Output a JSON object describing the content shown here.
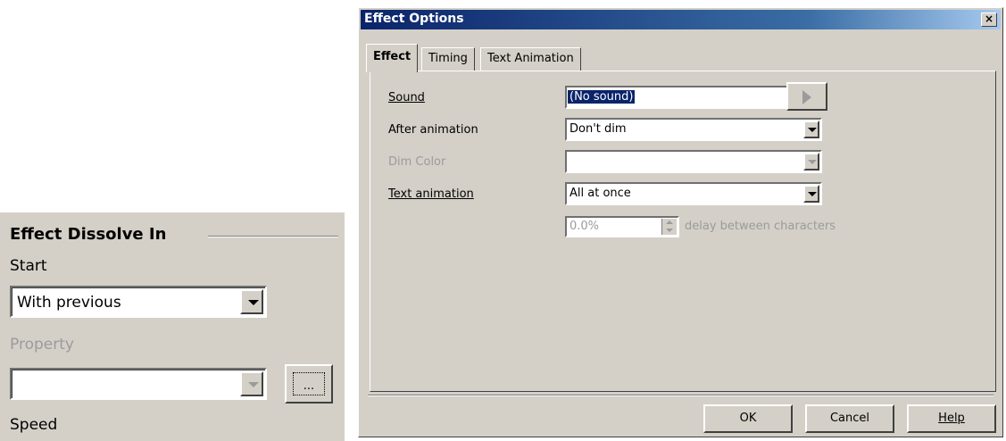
{
  "sidebar": {
    "title": "Effect Dissolve In",
    "start_label": "Start",
    "start_value": "With previous",
    "property_label": "Property",
    "property_value": "",
    "more_button_label": "...",
    "speed_label": "Speed"
  },
  "dialog": {
    "title": "Effect Options",
    "close_label": "×",
    "tabs": [
      {
        "label": "Effect",
        "active": true
      },
      {
        "label": "Timing",
        "active": false
      },
      {
        "label": "Text Animation",
        "active": false
      }
    ],
    "fields": {
      "sound": {
        "label": "Sound",
        "value": "(No sound)"
      },
      "after_animation": {
        "label": "After animation",
        "value": "Don't dim"
      },
      "dim_color": {
        "label": "Dim Color",
        "value": "",
        "disabled": true
      },
      "text_animation": {
        "label": "Text animation",
        "value": "All at once"
      },
      "delay": {
        "value": "0.0%",
        "suffix": "delay between characters",
        "disabled": true
      }
    },
    "buttons": {
      "ok": "OK",
      "cancel": "Cancel",
      "help": "Help"
    }
  },
  "icons": {
    "play": "play-icon",
    "close": "close-icon",
    "dropdown": "chevron-down-icon",
    "spin": "spin-arrows-icon",
    "annotation": "big-arrow-icon"
  },
  "colors": {
    "face": "#d4d0c8",
    "titlebar_start": "#0a246a",
    "titlebar_end": "#a6caf0",
    "selection": "#0a246a",
    "disabled_text": "#9b9b9b"
  }
}
